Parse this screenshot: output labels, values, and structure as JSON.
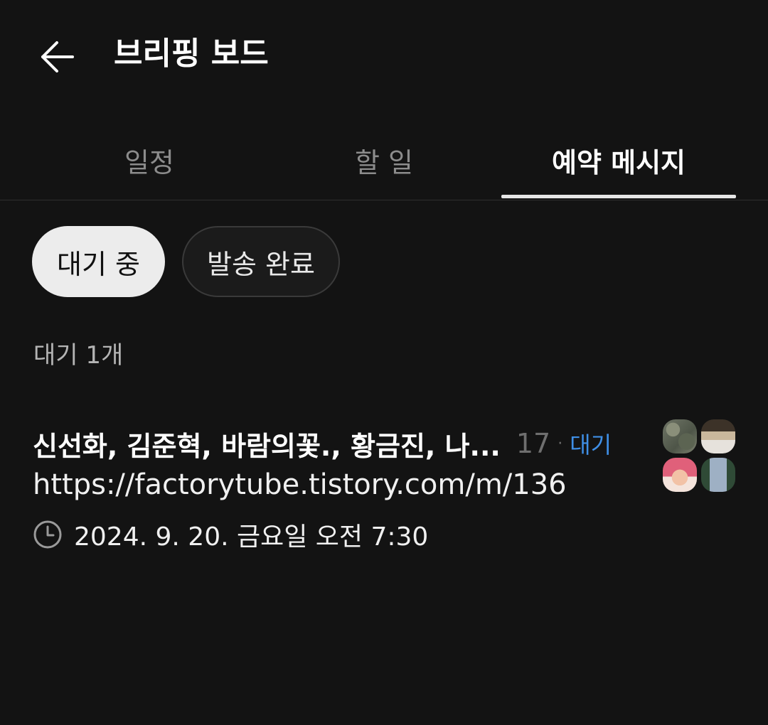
{
  "header": {
    "title": "브리핑 보드",
    "back_icon": "arrow-left-icon"
  },
  "tabs": [
    {
      "label": "일정",
      "active": false
    },
    {
      "label": "할 일",
      "active": false
    },
    {
      "label": "예약 메시지",
      "active": true
    }
  ],
  "filters": {
    "pending_label": "대기 중",
    "sent_label": "발송 완료",
    "selected": "pending"
  },
  "section": {
    "count_label": "대기 1개"
  },
  "messages": [
    {
      "recipients": "신선화, 김준혁, 바람의꽃., 황금진, 나...",
      "recipient_count": "17",
      "separator": "·",
      "status": "대기",
      "status_color": "#3f8fe6",
      "content": "https://factorytube.tistory.com/m/136",
      "scheduled_time": "2024. 9. 20. 금요일 오전 7:30",
      "time_icon": "clock-icon"
    }
  ],
  "colors": {
    "background": "#131313",
    "tab_indicator": "#e6e6e6",
    "chip_selected_bg": "#ececec",
    "chip_unselected_bg": "#1b1b1b"
  }
}
